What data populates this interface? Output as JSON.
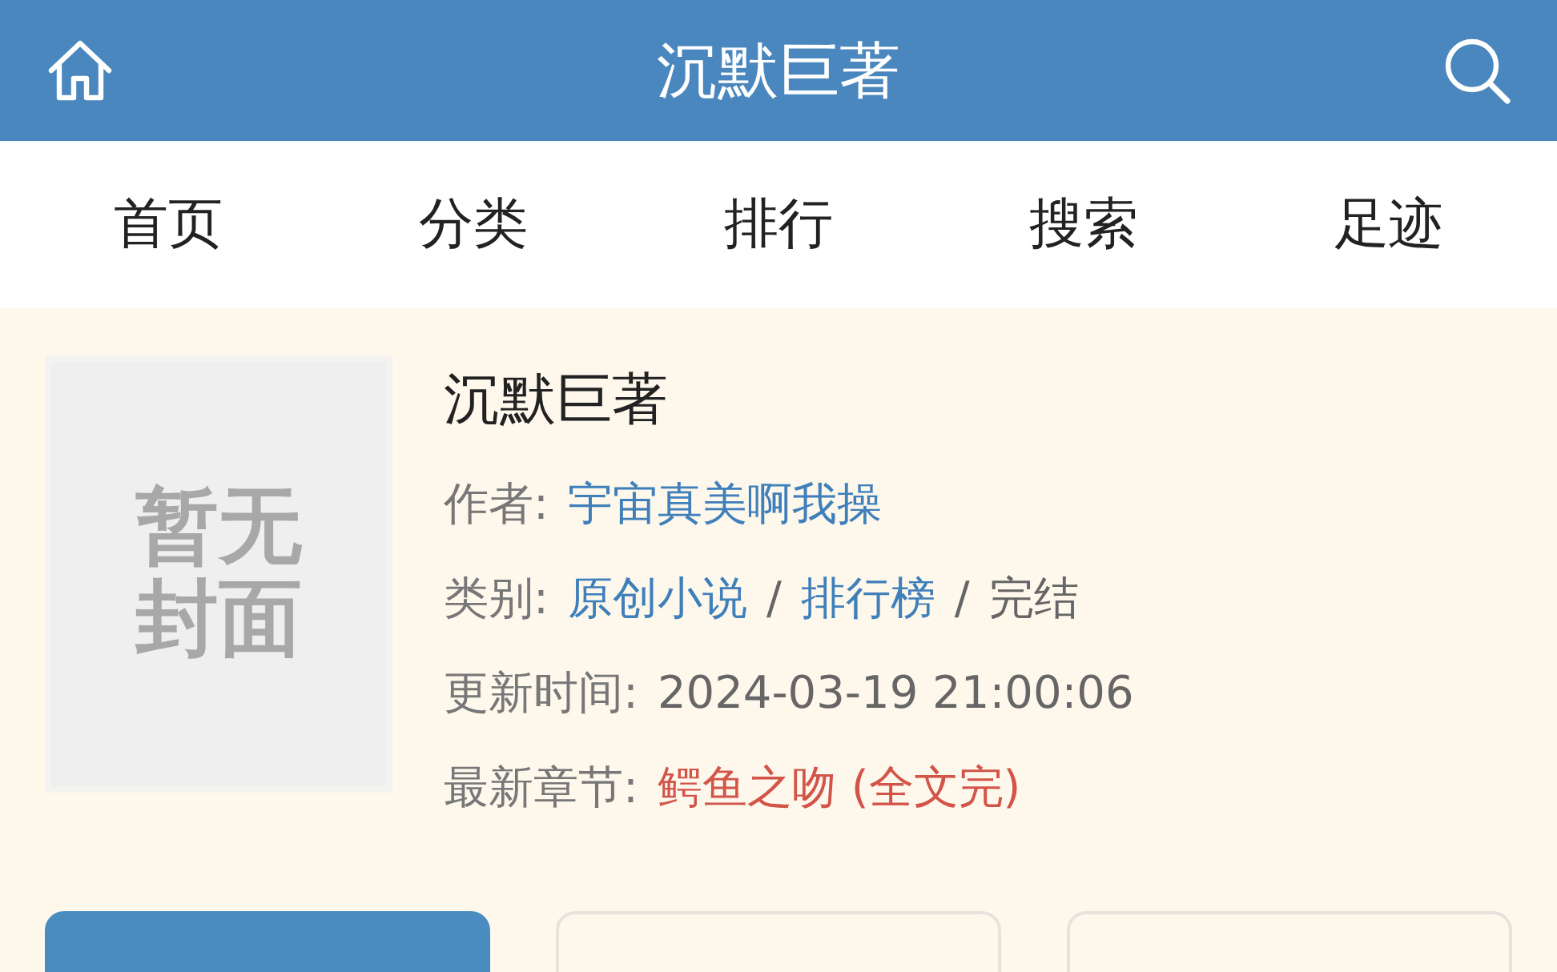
{
  "header": {
    "title": "沉默巨著"
  },
  "nav": [
    {
      "label": "首页"
    },
    {
      "label": "分类"
    },
    {
      "label": "排行"
    },
    {
      "label": "搜索"
    },
    {
      "label": "足迹"
    }
  ],
  "book": {
    "cover_label": "暂无封面",
    "title": "沉默巨著",
    "rows": [
      {
        "label": "作者:",
        "parts": [
          {
            "text": "宇宙真美啊我操",
            "kind": "link"
          }
        ]
      },
      {
        "label": "类别:",
        "parts": [
          {
            "text": "原创小说",
            "kind": "link"
          },
          {
            "text": "/",
            "kind": "sep"
          },
          {
            "text": "排行榜",
            "kind": "link"
          },
          {
            "text": "/",
            "kind": "sep"
          },
          {
            "text": "完结",
            "kind": "plain"
          }
        ]
      },
      {
        "label": "更新时间:",
        "parts": [
          {
            "text": "2024-03-19 21:00:06",
            "kind": "plain"
          }
        ]
      },
      {
        "label": "最新章节:",
        "parts": [
          {
            "text": "鳄鱼之吻 (全文完)",
            "kind": "latest"
          }
        ]
      }
    ]
  },
  "actions": [
    {
      "kind": "primary"
    },
    {
      "kind": "outline"
    },
    {
      "kind": "outline"
    }
  ]
}
